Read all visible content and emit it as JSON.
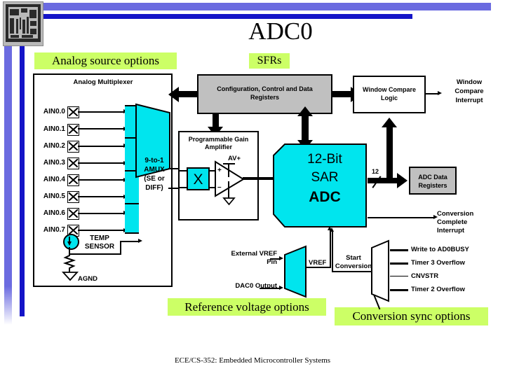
{
  "slide": {
    "title": "ADC0",
    "footer": "ECE/CS-352: Embedded Microcontroller Systems"
  },
  "callouts": {
    "analog_source": "Analog source options",
    "sfrs": "SFRs",
    "reference_voltage": "Reference voltage options",
    "conversion_sync": "Conversion sync options"
  },
  "mux_panel": {
    "title": "Analog Multiplexer",
    "inputs": [
      {
        "label": "AIN0.0",
        "polarity": "+"
      },
      {
        "label": "AIN0.1",
        "polarity": "-"
      },
      {
        "label": "AIN0.2",
        "polarity": "+"
      },
      {
        "label": "AIN0.3",
        "polarity": "-"
      },
      {
        "label": "AIN0.4",
        "polarity": "+"
      },
      {
        "label": "AIN0.5",
        "polarity": "-"
      },
      {
        "label": "AIN0.6",
        "polarity": "+"
      },
      {
        "label": "AIN0.7",
        "polarity": "-"
      }
    ],
    "temp_sensor": "TEMP\nSENSOR",
    "temp_sensor_line1": "TEMP",
    "temp_sensor_line2": "SENSOR",
    "ground": "AGND",
    "amux_line1": "9-to-1",
    "amux_line2": "AMUX",
    "amux_line3": "(SE or",
    "amux_line4": "DIFF)"
  },
  "sfr_block": {
    "line1": "Configuration, Control  and Data",
    "line2": "Registers"
  },
  "pga_block": {
    "title_line1": "Programmable Gain",
    "title_line2": "Amplifier",
    "gain_symbol": "X",
    "supply": "AV+"
  },
  "adc_block": {
    "line1": "12-Bit",
    "line2": "SAR",
    "line3": "ADC",
    "bus_width": "12"
  },
  "window_compare": {
    "box_line1": "Window Compare",
    "box_line2": "Logic",
    "interrupt_line1": "Window",
    "interrupt_line2": "Compare",
    "interrupt_line3": "Interrupt"
  },
  "data_registers": {
    "line1": "ADC Data",
    "line2": "Registers"
  },
  "conversion_complete": {
    "line1": "Conversion",
    "line2": "Complete",
    "line3": "Interrupt"
  },
  "vref_block": {
    "external_line1": "External VREF",
    "external_line2": "Pin",
    "dac_output": "DAC0 Output",
    "output": "VREF"
  },
  "start_conversion": {
    "label_line1": "Start",
    "label_line2": "Conversion",
    "sources": [
      "Write to AD0BUSY",
      "Timer 3 Overflow",
      "CNVSTR",
      "Timer 2 Overflow"
    ]
  },
  "colors": {
    "highlight": "#ccff66",
    "cyan": "#00e5ee",
    "gray": "#c0c0c0",
    "frame_dark_blue": "#1414c8",
    "frame_light_blue": "#6b6be0"
  }
}
